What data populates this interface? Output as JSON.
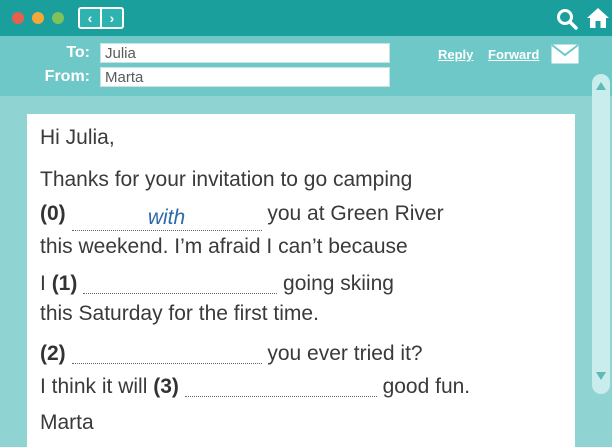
{
  "colors": {
    "titlebar": "#1a9f9c",
    "header": "#6ec8c8",
    "background": "#8fd3d3",
    "filled_answer": "#2c6aa8"
  },
  "toolbar": {
    "back": "‹",
    "forward": "›"
  },
  "header": {
    "to_label": "To:",
    "to_value": "Julia",
    "from_label": "From:",
    "from_value": "Marta",
    "reply": "Reply",
    "forward": "Forward"
  },
  "letter": {
    "greeting": "Hi Julia,",
    "l1": "Thanks for your invitation to go camping",
    "n0": "(0)",
    "a0": "with",
    "l2b": "you at Green River",
    "l3": "this weekend. I’m afraid I can’t because",
    "l4a": "I",
    "n1": "(1)",
    "l4b": "going skiing",
    "l5": "this Saturday for the first time.",
    "n2": "(2)",
    "l6b": "you ever tried it?",
    "l7a": "I think it will",
    "n3": "(3)",
    "l7b": "good fun.",
    "signature": "Marta"
  }
}
